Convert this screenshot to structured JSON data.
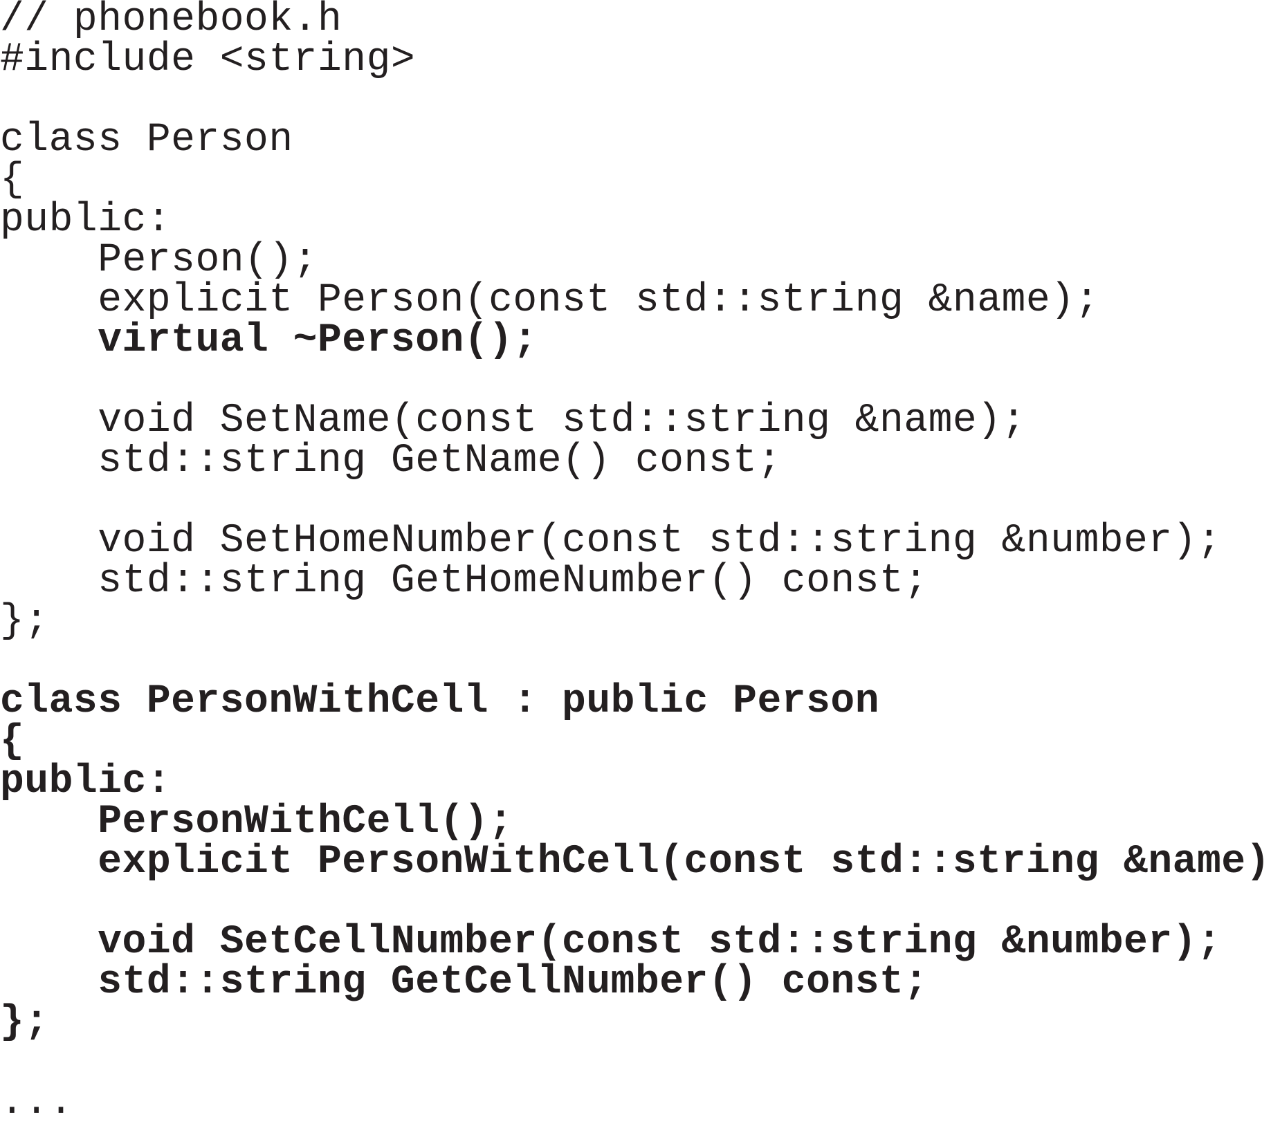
{
  "code": {
    "lines": [
      {
        "text": "// phonebook.h",
        "bold": false
      },
      {
        "text": "#include <string>",
        "bold": false
      },
      {
        "text": "",
        "bold": false
      },
      {
        "text": "class Person",
        "bold": false
      },
      {
        "text": "{",
        "bold": false
      },
      {
        "text": "public:",
        "bold": false
      },
      {
        "text": "    Person();",
        "bold": false
      },
      {
        "text": "    explicit Person(const std::string &name);",
        "bold": false
      },
      {
        "text": "    virtual ~Person();",
        "bold": true
      },
      {
        "text": "",
        "bold": false
      },
      {
        "text": "    void SetName(const std::string &name);",
        "bold": false
      },
      {
        "text": "    std::string GetName() const;",
        "bold": false
      },
      {
        "text": "",
        "bold": false
      },
      {
        "text": "    void SetHomeNumber(const std::string &number);",
        "bold": false
      },
      {
        "text": "    std::string GetHomeNumber() const;",
        "bold": false
      },
      {
        "text": "};",
        "bold": false
      },
      {
        "text": "",
        "bold": false
      },
      {
        "text": "class PersonWithCell : public Person",
        "bold": true
      },
      {
        "text": "{",
        "bold": true
      },
      {
        "text": "public:",
        "bold": true
      },
      {
        "text": "    PersonWithCell();",
        "bold": true
      },
      {
        "text": "    explicit PersonWithCell(const std::string &name);",
        "bold": true
      },
      {
        "text": "",
        "bold": false
      },
      {
        "text": "    void SetCellNumber(const std::string &number);",
        "bold": true
      },
      {
        "text": "    std::string GetCellNumber() const;",
        "bold": true
      },
      {
        "text": "};",
        "bold": true
      },
      {
        "text": "",
        "bold": false
      },
      {
        "text": "...",
        "bold": false
      }
    ]
  }
}
